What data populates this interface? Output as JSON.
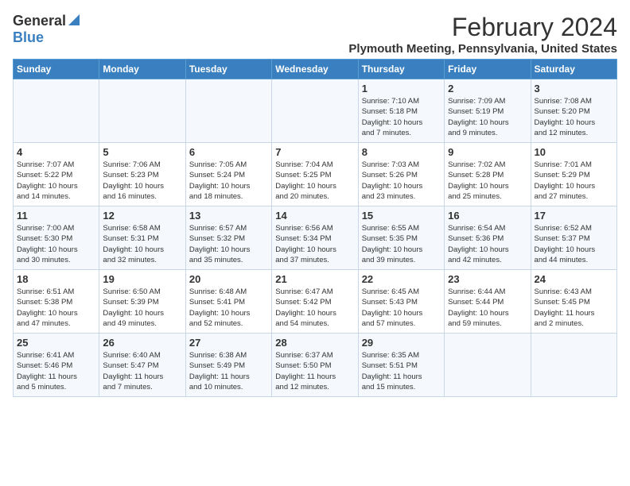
{
  "header": {
    "logo_general": "General",
    "logo_blue": "Blue",
    "month": "February 2024",
    "location": "Plymouth Meeting, Pennsylvania, United States"
  },
  "days_of_week": [
    "Sunday",
    "Monday",
    "Tuesday",
    "Wednesday",
    "Thursday",
    "Friday",
    "Saturday"
  ],
  "weeks": [
    [
      {
        "day": "",
        "content": ""
      },
      {
        "day": "",
        "content": ""
      },
      {
        "day": "",
        "content": ""
      },
      {
        "day": "",
        "content": ""
      },
      {
        "day": "1",
        "content": "Sunrise: 7:10 AM\nSunset: 5:18 PM\nDaylight: 10 hours\nand 7 minutes."
      },
      {
        "day": "2",
        "content": "Sunrise: 7:09 AM\nSunset: 5:19 PM\nDaylight: 10 hours\nand 9 minutes."
      },
      {
        "day": "3",
        "content": "Sunrise: 7:08 AM\nSunset: 5:20 PM\nDaylight: 10 hours\nand 12 minutes."
      }
    ],
    [
      {
        "day": "4",
        "content": "Sunrise: 7:07 AM\nSunset: 5:22 PM\nDaylight: 10 hours\nand 14 minutes."
      },
      {
        "day": "5",
        "content": "Sunrise: 7:06 AM\nSunset: 5:23 PM\nDaylight: 10 hours\nand 16 minutes."
      },
      {
        "day": "6",
        "content": "Sunrise: 7:05 AM\nSunset: 5:24 PM\nDaylight: 10 hours\nand 18 minutes."
      },
      {
        "day": "7",
        "content": "Sunrise: 7:04 AM\nSunset: 5:25 PM\nDaylight: 10 hours\nand 20 minutes."
      },
      {
        "day": "8",
        "content": "Sunrise: 7:03 AM\nSunset: 5:26 PM\nDaylight: 10 hours\nand 23 minutes."
      },
      {
        "day": "9",
        "content": "Sunrise: 7:02 AM\nSunset: 5:28 PM\nDaylight: 10 hours\nand 25 minutes."
      },
      {
        "day": "10",
        "content": "Sunrise: 7:01 AM\nSunset: 5:29 PM\nDaylight: 10 hours\nand 27 minutes."
      }
    ],
    [
      {
        "day": "11",
        "content": "Sunrise: 7:00 AM\nSunset: 5:30 PM\nDaylight: 10 hours\nand 30 minutes."
      },
      {
        "day": "12",
        "content": "Sunrise: 6:58 AM\nSunset: 5:31 PM\nDaylight: 10 hours\nand 32 minutes."
      },
      {
        "day": "13",
        "content": "Sunrise: 6:57 AM\nSunset: 5:32 PM\nDaylight: 10 hours\nand 35 minutes."
      },
      {
        "day": "14",
        "content": "Sunrise: 6:56 AM\nSunset: 5:34 PM\nDaylight: 10 hours\nand 37 minutes."
      },
      {
        "day": "15",
        "content": "Sunrise: 6:55 AM\nSunset: 5:35 PM\nDaylight: 10 hours\nand 39 minutes."
      },
      {
        "day": "16",
        "content": "Sunrise: 6:54 AM\nSunset: 5:36 PM\nDaylight: 10 hours\nand 42 minutes."
      },
      {
        "day": "17",
        "content": "Sunrise: 6:52 AM\nSunset: 5:37 PM\nDaylight: 10 hours\nand 44 minutes."
      }
    ],
    [
      {
        "day": "18",
        "content": "Sunrise: 6:51 AM\nSunset: 5:38 PM\nDaylight: 10 hours\nand 47 minutes."
      },
      {
        "day": "19",
        "content": "Sunrise: 6:50 AM\nSunset: 5:39 PM\nDaylight: 10 hours\nand 49 minutes."
      },
      {
        "day": "20",
        "content": "Sunrise: 6:48 AM\nSunset: 5:41 PM\nDaylight: 10 hours\nand 52 minutes."
      },
      {
        "day": "21",
        "content": "Sunrise: 6:47 AM\nSunset: 5:42 PM\nDaylight: 10 hours\nand 54 minutes."
      },
      {
        "day": "22",
        "content": "Sunrise: 6:45 AM\nSunset: 5:43 PM\nDaylight: 10 hours\nand 57 minutes."
      },
      {
        "day": "23",
        "content": "Sunrise: 6:44 AM\nSunset: 5:44 PM\nDaylight: 10 hours\nand 59 minutes."
      },
      {
        "day": "24",
        "content": "Sunrise: 6:43 AM\nSunset: 5:45 PM\nDaylight: 11 hours\nand 2 minutes."
      }
    ],
    [
      {
        "day": "25",
        "content": "Sunrise: 6:41 AM\nSunset: 5:46 PM\nDaylight: 11 hours\nand 5 minutes."
      },
      {
        "day": "26",
        "content": "Sunrise: 6:40 AM\nSunset: 5:47 PM\nDaylight: 11 hours\nand 7 minutes."
      },
      {
        "day": "27",
        "content": "Sunrise: 6:38 AM\nSunset: 5:49 PM\nDaylight: 11 hours\nand 10 minutes."
      },
      {
        "day": "28",
        "content": "Sunrise: 6:37 AM\nSunset: 5:50 PM\nDaylight: 11 hours\nand 12 minutes."
      },
      {
        "day": "29",
        "content": "Sunrise: 6:35 AM\nSunset: 5:51 PM\nDaylight: 11 hours\nand 15 minutes."
      },
      {
        "day": "",
        "content": ""
      },
      {
        "day": "",
        "content": ""
      }
    ]
  ]
}
